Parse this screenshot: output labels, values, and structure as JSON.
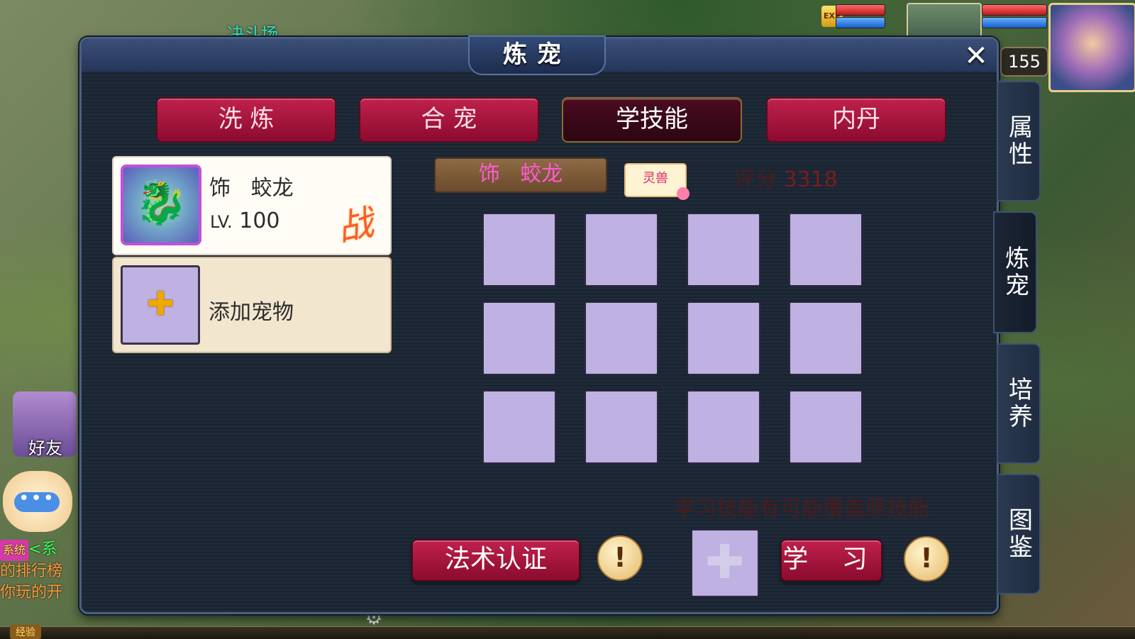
{
  "scene": {
    "location_label": "决斗场"
  },
  "hud": {
    "level": "155",
    "exp_icon_text": "EXP",
    "colors": {
      "hp": "#d22a2a",
      "mp": "#1f6fd6"
    }
  },
  "left_ui": {
    "friend_label": "好友",
    "chat_dots": "•••",
    "chat_log": [
      {
        "tag": "系统",
        "text": "<系"
      },
      {
        "text": "的排行榜"
      },
      {
        "text": "你玩的开"
      }
    ],
    "exp_label": "经验"
  },
  "panel": {
    "title": "炼宠",
    "close_icon": "✕",
    "tabs": [
      {
        "label": "洗 炼",
        "active": false
      },
      {
        "label": "合 宠",
        "active": false
      },
      {
        "label": "学技能",
        "active": true
      },
      {
        "label": "内丹",
        "active": false
      }
    ],
    "side_tabs": [
      {
        "label": "属性",
        "active": false
      },
      {
        "label": "炼宠",
        "active": true
      },
      {
        "label": "培养",
        "active": false
      },
      {
        "label": "图鉴",
        "active": false
      }
    ],
    "pet": {
      "name": "饰   蛟龙",
      "level_prefix": "LV.",
      "level": "100",
      "status_mark": "战",
      "portrait_icon": "dragon-icon"
    },
    "add_pet": {
      "label": "添加宠物",
      "icon": "plus-icon"
    },
    "selected": {
      "name": "饰   蛟龙",
      "type_badge": "灵兽",
      "score_label": "评分",
      "score_value": "3318"
    },
    "skill_slots_count": 12,
    "hint": "学习技能有可能覆盖原技能",
    "buttons": {
      "certify": "法术认证",
      "learn": "学 习",
      "info_mark": "!"
    },
    "colors": {
      "tab_red": "#a8173d",
      "slot_lavender": "#bfb1e2",
      "pet_name_pink": "#ff5ad2",
      "hint_text": "#4a1c1c"
    }
  }
}
